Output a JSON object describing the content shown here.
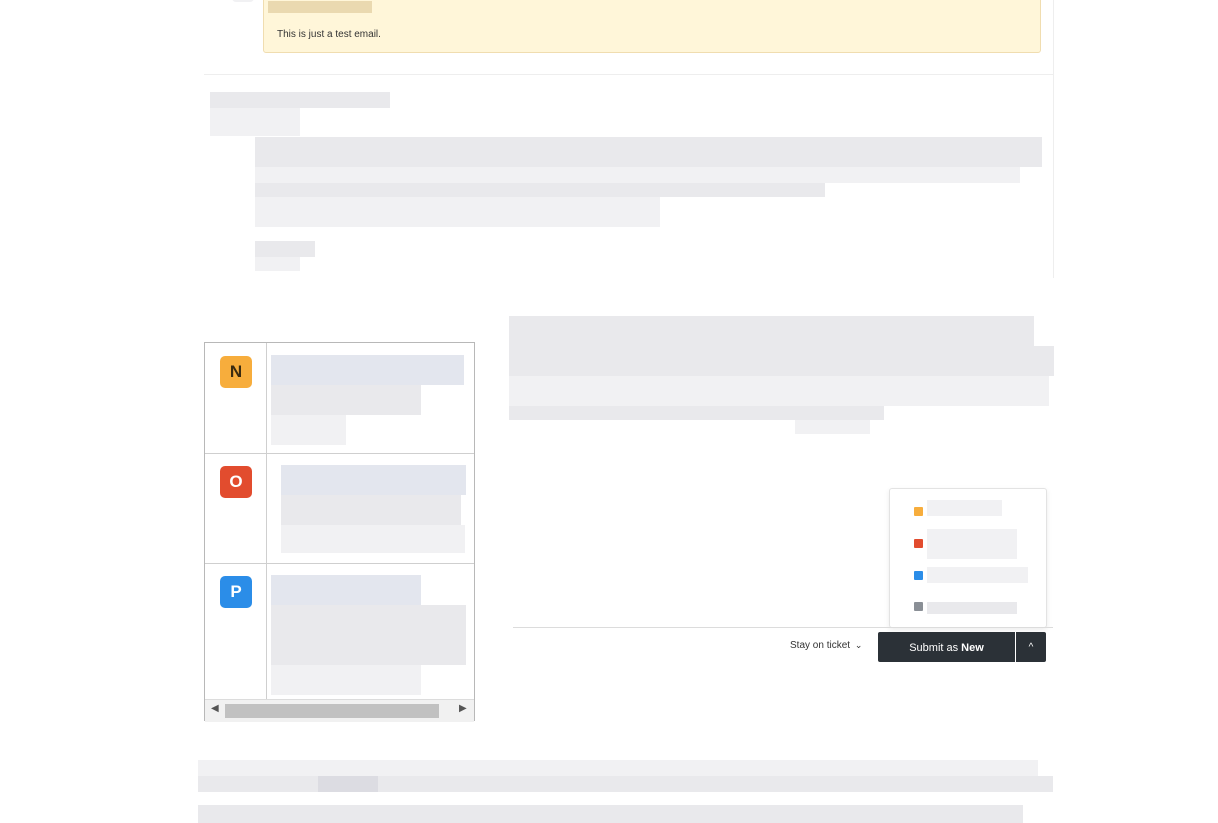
{
  "email": {
    "body_text": "This is just a test email."
  },
  "status_icons": [
    {
      "letter": "N",
      "color": "#f7ad3c",
      "icon": "new-status-icon"
    },
    {
      "letter": "O",
      "color": "#e24c2e",
      "icon": "open-status-icon"
    },
    {
      "letter": "P",
      "color": "#2b8de8",
      "icon": "pending-status-icon"
    }
  ],
  "status_menu": {
    "colors": [
      "#f7ad3c",
      "#e24c2e",
      "#2b8de8",
      "#8a8f96"
    ]
  },
  "actions": {
    "stay_label": "Stay on ticket",
    "stay_caret": "⌄",
    "submit_prefix": "Submit as ",
    "submit_status": "New",
    "caret_up": "^"
  }
}
